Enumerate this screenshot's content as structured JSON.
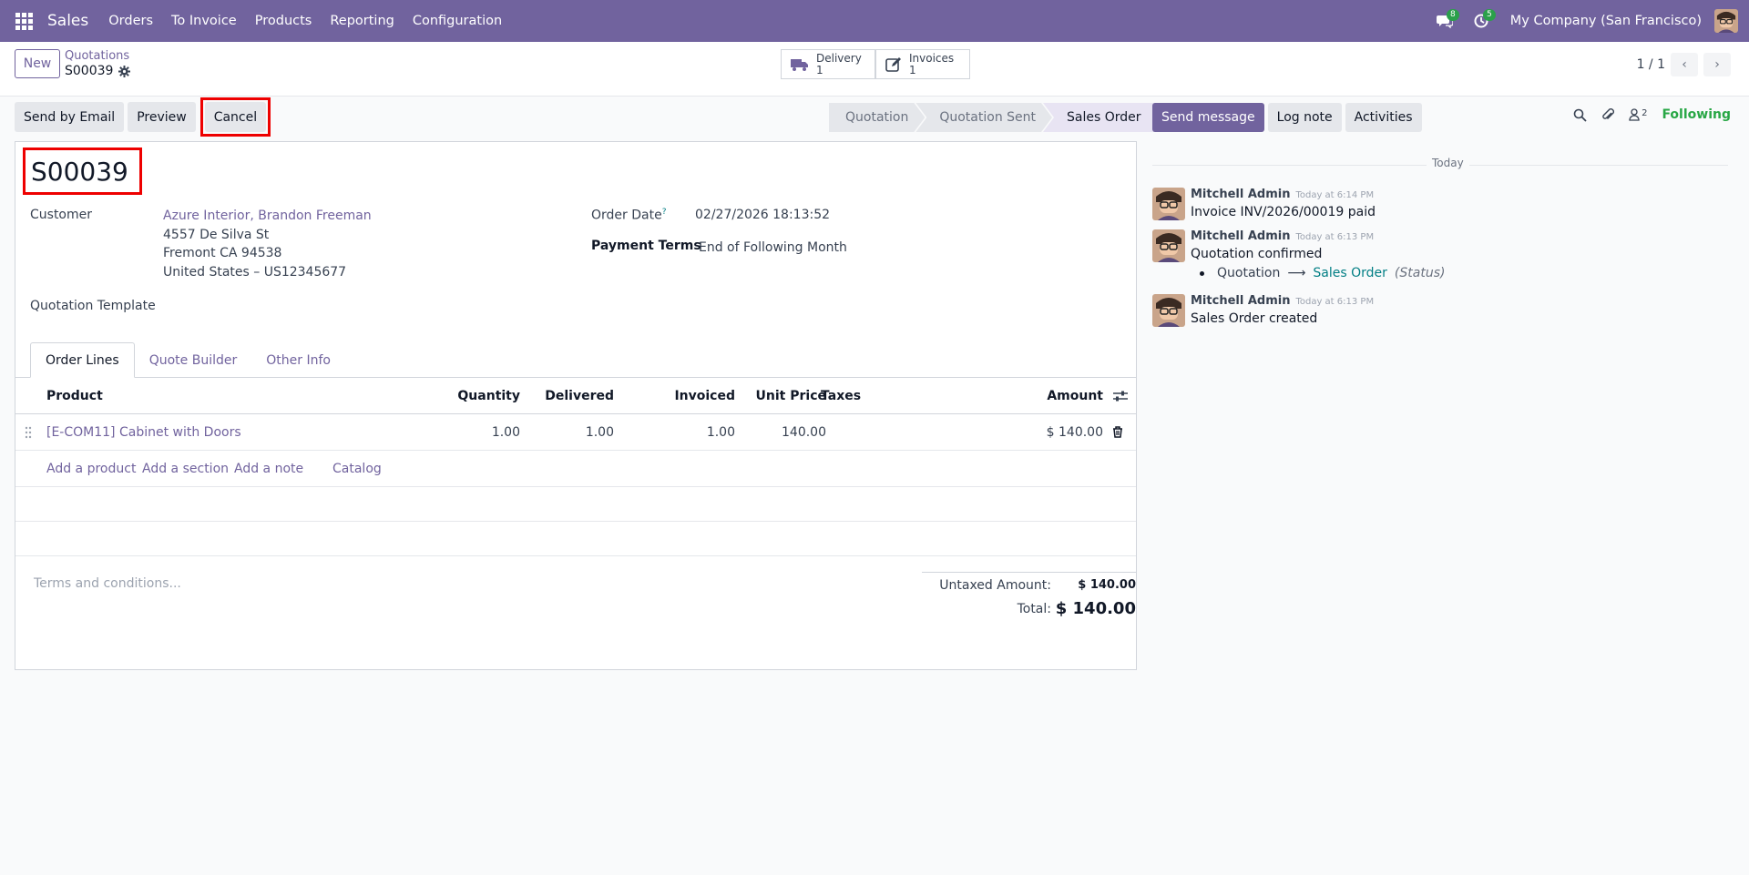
{
  "navbar": {
    "app_name": "Sales",
    "menu": [
      "Orders",
      "To Invoice",
      "Products",
      "Reporting",
      "Configuration"
    ],
    "messages_count": "8",
    "activities_count": "5",
    "company": "My Company (San Francisco)"
  },
  "control_panel": {
    "new_label": "New",
    "breadcrumb_parent": "Quotations",
    "breadcrumb_current": "S00039",
    "smart_buttons": [
      {
        "label": "Delivery",
        "value": "1",
        "icon": "truck-icon"
      },
      {
        "label": "Invoices",
        "value": "1",
        "icon": "pencil-square-icon"
      }
    ],
    "pager": "1 / 1"
  },
  "actions": {
    "send_email": "Send by Email",
    "preview": "Preview",
    "cancel": "Cancel"
  },
  "status": {
    "stages": [
      "Quotation",
      "Quotation Sent",
      "Sales Order"
    ],
    "active": "Sales Order"
  },
  "form": {
    "name": "S00039",
    "customer_label": "Customer",
    "customer_name": "Azure Interior, Brandon Freeman",
    "address_line1": "4557 De Silva St",
    "address_line2": "Fremont CA 94538",
    "address_line3": "United States – US12345677",
    "template_label": "Quotation Template",
    "order_date_label": "Order Date",
    "order_date_help": "?",
    "order_date": "02/27/2026 18:13:52",
    "payment_terms_label": "Payment Terms",
    "payment_terms": "End of Following Month"
  },
  "tabs": [
    "Order Lines",
    "Quote Builder",
    "Other Info"
  ],
  "order_lines": {
    "headers": {
      "product": "Product",
      "quantity": "Quantity",
      "delivered": "Delivered",
      "invoiced": "Invoiced",
      "unit_price": "Unit Price",
      "taxes": "Taxes",
      "amount": "Amount"
    },
    "rows": [
      {
        "product": "[E-COM11] Cabinet with Doors",
        "quantity": "1.00",
        "delivered": "1.00",
        "invoiced": "1.00",
        "unit_price": "140.00",
        "taxes": "",
        "amount": "$ 140.00"
      }
    ],
    "add_product": "Add a product",
    "add_section": "Add a section",
    "add_note": "Add a note",
    "catalog": "Catalog"
  },
  "totals": {
    "terms_placeholder": "Terms and conditions...",
    "untaxed_label": "Untaxed Amount:",
    "untaxed_value": "$ 140.00",
    "total_label": "Total:",
    "total_value": "$ 140.00"
  },
  "chatter": {
    "send_message": "Send message",
    "log_note": "Log note",
    "activities": "Activities",
    "followers_count": "2",
    "following": "Following",
    "date_separator": "Today",
    "messages": [
      {
        "author": "Mitchell Admin",
        "time": "Today at 6:14 PM",
        "body": "Invoice INV/2026/00019 paid"
      },
      {
        "author": "Mitchell Admin",
        "time": "Today at 6:13 PM",
        "body": "Quotation confirmed",
        "tracking": {
          "old": "Quotation",
          "arrow": "⟶",
          "new": "Sales Order",
          "field": "(Status)"
        }
      },
      {
        "author": "Mitchell Admin",
        "time": "Today at 6:13 PM",
        "body": "Sales Order created"
      }
    ]
  },
  "colors": {
    "brand": "#71639e",
    "highlight_box": "#ee0000",
    "following": "#28a745",
    "badge": "#2aa04a"
  }
}
